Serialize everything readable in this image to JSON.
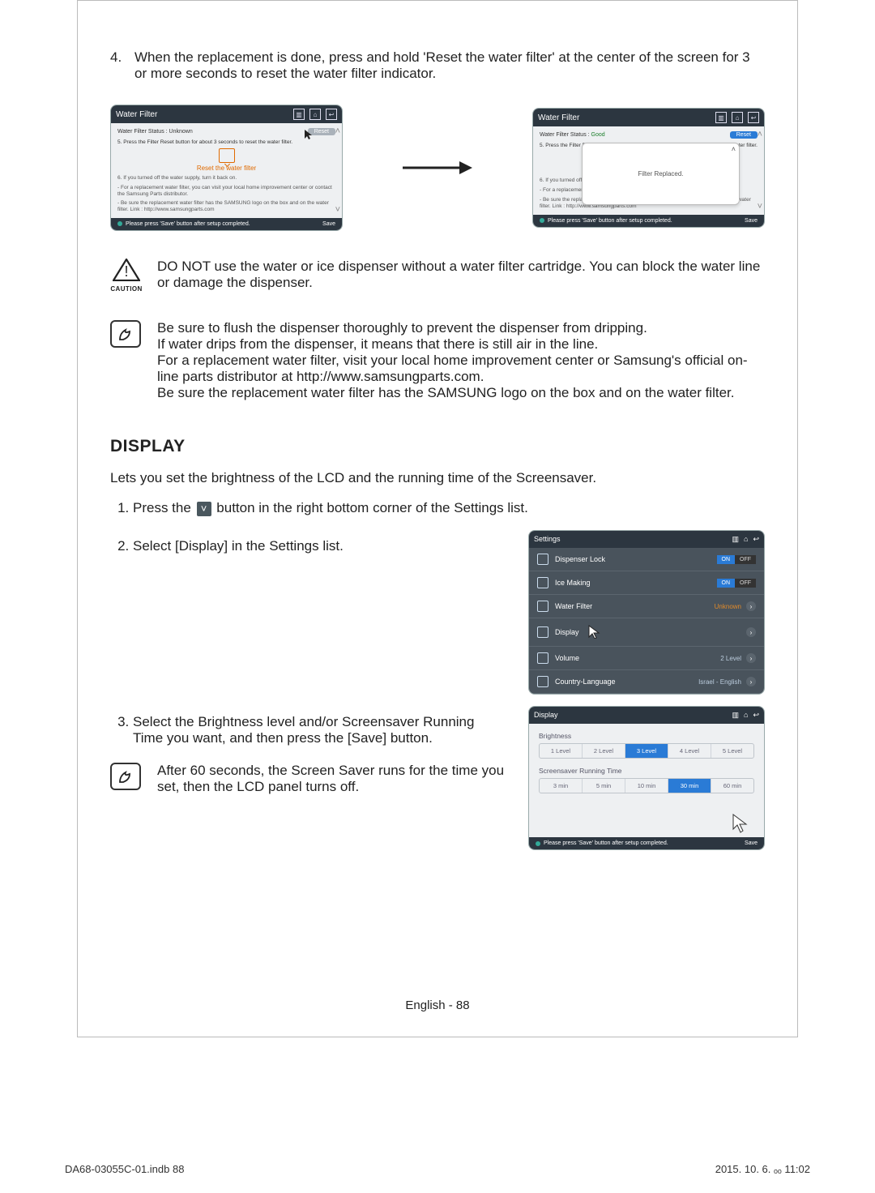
{
  "step4": {
    "num": "4.",
    "text": "When the replacement is done, press and hold 'Reset the water filter' at the center of the screen for 3 or more seconds to reset the water filter indicator."
  },
  "shotA": {
    "title": "Water Filter",
    "status_label": "Water Filter Status : Unknown",
    "step5": "5. Press the Filter Reset button for about 3 seconds to reset the water filter.",
    "reset_label": "Reset the water filter",
    "reset_btn": "Reset",
    "step6_head": "6. If you turned off the water supply, turn it back on.",
    "step6_a": "- For a replacement water filter, you can visit your local home improvement center or contact the Samsung Parts distributor.",
    "step6_b": "- Be sure the replacement water filter has the SAMSUNG logo on the box and on the water filter. Link : http://www.samsungparts.com",
    "footer_msg": "Please press 'Save' button after setup completed.",
    "save": "Save"
  },
  "shotB": {
    "title": "Water Filter",
    "status_label": "Water Filter Status :",
    "status_value": "Good",
    "step5": "5. Press the Filter Rese",
    "modal": "Filter Replaced.",
    "tail_a": "water filter.",
    "step6_head": "6. If you turned off the",
    "step6_a": "- For a replacement wate                                                               ement center or contact the Samsung Pa",
    "step6_b": "- Be sure the replacement water filter has the SAMSUNG logo on the box and on the water filter. Link : http://www.samsungparts.com",
    "reset_btn": "Reset",
    "footer_msg": "Please press 'Save' button after setup completed.",
    "save": "Save"
  },
  "caution": {
    "label": "CAUTION",
    "text": "DO NOT use the water or ice dispenser without a water filter cartridge. You can block the water line or damage the dispenser."
  },
  "note": {
    "l1": "Be sure to flush the dispenser thoroughly to prevent the dispenser from dripping.",
    "l2": "If water drips from the dispenser, it means that there is still air in the line.",
    "l3": "For a replacement water filter, visit your local home improvement center or Samsung's official on-line parts distributor at http://www.samsungparts.com.",
    "l4": "Be sure the replacement water filter has the SAMSUNG logo on the box and on the water filter."
  },
  "display_heading": "DISPLAY",
  "display_intro": "Lets you set the brightness of the LCD and the running time of the Screensaver.",
  "display_steps": {
    "s1a": "Press the",
    "s1b": "button in the right bottom corner of the Settings list.",
    "s2": "Select [Display] in the Settings list.",
    "s3": "Select the Brightness level and/or Screensaver Running Time you want, and then press the [Save] button."
  },
  "note2": "After 60 seconds, the Screen Saver runs for the time you set, then the LCD panel turns off.",
  "settings_mini": {
    "title": "Settings",
    "rows": [
      {
        "label": "Dispenser Lock",
        "toggle_on": "ON",
        "toggle_off": "OFF",
        "on_sel": true
      },
      {
        "label": "Ice Making",
        "toggle_on": "ON",
        "toggle_off": "OFF",
        "on_sel": true
      },
      {
        "label": "Water Filter",
        "value": "Unknown",
        "unk": true
      },
      {
        "label": "Display"
      },
      {
        "label": "Volume",
        "value": "2 Level"
      },
      {
        "label": "Country-Language",
        "value": "Israel - English"
      }
    ]
  },
  "display_mini": {
    "title": "Display",
    "group1": "Brightness",
    "levels": [
      "1 Level",
      "2 Level",
      "3 Level",
      "4 Level",
      "5 Level"
    ],
    "level_sel": 2,
    "group2": "Screensaver Running Time",
    "times": [
      "3 min",
      "5 min",
      "10 min",
      "30 min",
      "60 min"
    ],
    "time_sel": 3,
    "footer_msg": "Please press 'Save' button after setup completed.",
    "save": "Save"
  },
  "page_footer": "English - 88",
  "print": {
    "left": "DA68-03055C-01.indb   88",
    "right": "2015. 10. 6.   ₒₒ 11:02"
  }
}
